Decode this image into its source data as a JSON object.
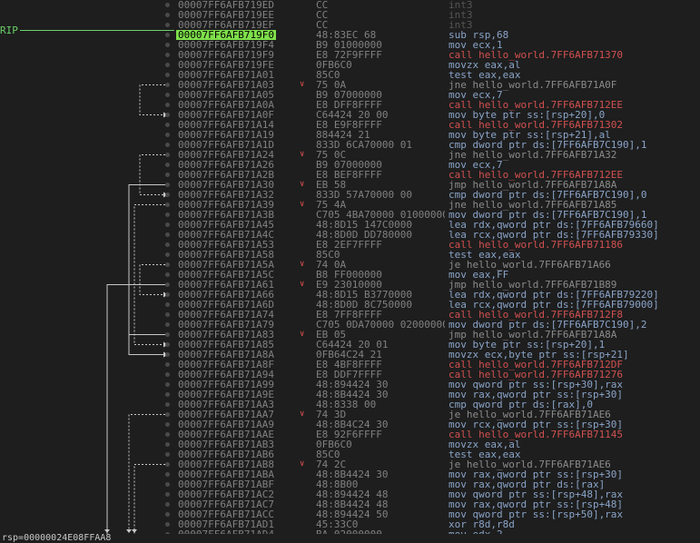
{
  "rip_label": "RIP",
  "rip_index": 3,
  "colors": {
    "rip_highlight": "#7fe04b",
    "call": "#d25050",
    "jump": "#e0604d",
    "normal": "#8aa4c8",
    "int3": "#555555"
  },
  "rows": [
    {
      "addr": "00007FF6AFB719ED",
      "bytes": "CC",
      "instr": "int3",
      "kind": "int3",
      "jmp": false
    },
    {
      "addr": "00007FF6AFB719EE",
      "bytes": "CC",
      "instr": "int3",
      "kind": "int3",
      "jmp": false
    },
    {
      "addr": "00007FF6AFB719EF",
      "bytes": "CC",
      "instr": "int3",
      "kind": "int3",
      "jmp": false
    },
    {
      "addr": "00007FF6AFB719F0",
      "bytes": "48:83EC 68",
      "instr": "sub rsp,68",
      "kind": "plain",
      "jmp": false
    },
    {
      "addr": "00007FF6AFB719F4",
      "bytes": "B9 01000000",
      "instr": "mov ecx,1",
      "kind": "plain",
      "jmp": false
    },
    {
      "addr": "00007FF6AFB719F9",
      "bytes": "E8 72F9FFFF",
      "instr": "call hello_world.7FF6AFB71370",
      "kind": "call",
      "jmp": false
    },
    {
      "addr": "00007FF6AFB719FE",
      "bytes": "0FB6C0",
      "instr": "movzx eax,al",
      "kind": "plain",
      "jmp": false
    },
    {
      "addr": "00007FF6AFB71A01",
      "bytes": "85C0",
      "instr": "test eax,eax",
      "kind": "plain",
      "jmp": false
    },
    {
      "addr": "00007FF6AFB71A03",
      "bytes": "75 0A",
      "instr": "jne hello_world.7FF6AFB71A0F",
      "kind": "jump",
      "jmp": true
    },
    {
      "addr": "00007FF6AFB71A05",
      "bytes": "B9 07000000",
      "instr": "mov ecx,7",
      "kind": "plain",
      "jmp": false
    },
    {
      "addr": "00007FF6AFB71A0A",
      "bytes": "E8 DFF8FFFF",
      "instr": "call hello_world.7FF6AFB712EE",
      "kind": "call",
      "jmp": false
    },
    {
      "addr": "00007FF6AFB71A0F",
      "bytes": "C64424 20 00",
      "instr": "mov byte ptr ss:[rsp+20],0",
      "kind": "plain",
      "jmp": false
    },
    {
      "addr": "00007FF6AFB71A14",
      "bytes": "E8 E9F8FFFF",
      "instr": "call hello_world.7FF6AFB71302",
      "kind": "call",
      "jmp": false
    },
    {
      "addr": "00007FF6AFB71A19",
      "bytes": "884424 21",
      "instr": "mov byte ptr ss:[rsp+21],al",
      "kind": "plain",
      "jmp": false
    },
    {
      "addr": "00007FF6AFB71A1D",
      "bytes": "833D 6CA70000 01",
      "instr": "cmp dword ptr ds:[7FF6AFB7C190],1",
      "kind": "plain",
      "jmp": false
    },
    {
      "addr": "00007FF6AFB71A24",
      "bytes": "75 0C",
      "instr": "jne hello_world.7FF6AFB71A32",
      "kind": "jump",
      "jmp": true
    },
    {
      "addr": "00007FF6AFB71A26",
      "bytes": "B9 07000000",
      "instr": "mov ecx,7",
      "kind": "plain",
      "jmp": false
    },
    {
      "addr": "00007FF6AFB71A2B",
      "bytes": "E8 BEF8FFFF",
      "instr": "call hello_world.7FF6AFB712EE",
      "kind": "call",
      "jmp": false
    },
    {
      "addr": "00007FF6AFB71A30",
      "bytes": "EB 58",
      "instr": "jmp hello_world.7FF6AFB71A8A",
      "kind": "jump",
      "jmp": true
    },
    {
      "addr": "00007FF6AFB71A32",
      "bytes": "833D 57A70000 00",
      "instr": "cmp dword ptr ds:[7FF6AFB7C190],0",
      "kind": "plain",
      "jmp": false
    },
    {
      "addr": "00007FF6AFB71A39",
      "bytes": "75 4A",
      "instr": "jne hello_world.7FF6AFB71A85",
      "kind": "jump",
      "jmp": true
    },
    {
      "addr": "00007FF6AFB71A3B",
      "bytes": "C705 4BA70000 01000000",
      "instr": "mov dword ptr ds:[7FF6AFB7C190],1",
      "kind": "plain",
      "jmp": false
    },
    {
      "addr": "00007FF6AFB71A45",
      "bytes": "48:8D15 147C0000",
      "instr": "lea rdx,qword ptr ds:[7FF6AFB79660]",
      "kind": "plain",
      "jmp": false
    },
    {
      "addr": "00007FF6AFB71A4C",
      "bytes": "48:8D0D DD780000",
      "instr": "lea rcx,qword ptr ds:[7FF6AFB79330]",
      "kind": "plain",
      "jmp": false
    },
    {
      "addr": "00007FF6AFB71A53",
      "bytes": "E8 2EF7FFFF",
      "instr": "call hello_world.7FF6AFB71186",
      "kind": "call",
      "jmp": false
    },
    {
      "addr": "00007FF6AFB71A58",
      "bytes": "85C0",
      "instr": "test eax,eax",
      "kind": "plain",
      "jmp": false
    },
    {
      "addr": "00007FF6AFB71A5A",
      "bytes": "74 0A",
      "instr": "je hello_world.7FF6AFB71A66",
      "kind": "jump",
      "jmp": true
    },
    {
      "addr": "00007FF6AFB71A5C",
      "bytes": "B8 FF000000",
      "instr": "mov eax,FF",
      "kind": "plain",
      "jmp": false
    },
    {
      "addr": "00007FF6AFB71A61",
      "bytes": "E9 23010000",
      "instr": "jmp hello_world.7FF6AFB71B89",
      "kind": "jump",
      "jmp": true
    },
    {
      "addr": "00007FF6AFB71A66",
      "bytes": "48:8D15 B3770000",
      "instr": "lea rdx,qword ptr ds:[7FF6AFB79220]",
      "kind": "plain",
      "jmp": false
    },
    {
      "addr": "00007FF6AFB71A6D",
      "bytes": "48:8D0D 8C750000",
      "instr": "lea rcx,qword ptr ds:[7FF6AFB79000]",
      "kind": "plain",
      "jmp": false
    },
    {
      "addr": "00007FF6AFB71A74",
      "bytes": "E8 7FF8FFFF",
      "instr": "call hello_world.7FF6AFB712F8",
      "kind": "call",
      "jmp": false
    },
    {
      "addr": "00007FF6AFB71A79",
      "bytes": "C705 0DA70000 02000000",
      "instr": "mov dword ptr ds:[7FF6AFB7C190],2",
      "kind": "plain",
      "jmp": false
    },
    {
      "addr": "00007FF6AFB71A83",
      "bytes": "EB 05",
      "instr": "jmp hello_world.7FF6AFB71A8A",
      "kind": "jump",
      "jmp": true
    },
    {
      "addr": "00007FF6AFB71A85",
      "bytes": "C64424 20 01",
      "instr": "mov byte ptr ss:[rsp+20],1",
      "kind": "plain",
      "jmp": false
    },
    {
      "addr": "00007FF6AFB71A8A",
      "bytes": "0FB64C24 21",
      "instr": "movzx ecx,byte ptr ss:[rsp+21]",
      "kind": "plain",
      "jmp": false
    },
    {
      "addr": "00007FF6AFB71A8F",
      "bytes": "E8 4BF8FFFF",
      "instr": "call hello_world.7FF6AFB712DF",
      "kind": "call",
      "jmp": false
    },
    {
      "addr": "00007FF6AFB71A94",
      "bytes": "E8 DDF7FFFF",
      "instr": "call hello_world.7FF6AFB71276",
      "kind": "call",
      "jmp": false
    },
    {
      "addr": "00007FF6AFB71A99",
      "bytes": "48:894424 30",
      "instr": "mov qword ptr ss:[rsp+30],rax",
      "kind": "plain",
      "jmp": false
    },
    {
      "addr": "00007FF6AFB71A9E",
      "bytes": "48:8B4424 30",
      "instr": "mov rax,qword ptr ss:[rsp+30]",
      "kind": "plain",
      "jmp": false
    },
    {
      "addr": "00007FF6AFB71AA3",
      "bytes": "48:8338 00",
      "instr": "cmp qword ptr ds:[rax],0",
      "kind": "plain",
      "jmp": false
    },
    {
      "addr": "00007FF6AFB71AA7",
      "bytes": "74 3D",
      "instr": "je hello_world.7FF6AFB71AE6",
      "kind": "jump",
      "jmp": true
    },
    {
      "addr": "00007FF6AFB71AA9",
      "bytes": "48:8B4C24 30",
      "instr": "mov rcx,qword ptr ss:[rsp+30]",
      "kind": "plain",
      "jmp": false
    },
    {
      "addr": "00007FF6AFB71AAE",
      "bytes": "E8 92F6FFFF",
      "instr": "call hello_world.7FF6AFB71145",
      "kind": "call",
      "jmp": false
    },
    {
      "addr": "00007FF6AFB71AB3",
      "bytes": "0FB6C0",
      "instr": "movzx eax,al",
      "kind": "plain",
      "jmp": false
    },
    {
      "addr": "00007FF6AFB71AB6",
      "bytes": "85C0",
      "instr": "test eax,eax",
      "kind": "plain",
      "jmp": false
    },
    {
      "addr": "00007FF6AFB71AB8",
      "bytes": "74 2C",
      "instr": "je hello_world.7FF6AFB71AE6",
      "kind": "jump",
      "jmp": true
    },
    {
      "addr": "00007FF6AFB71ABA",
      "bytes": "48:8B4424 30",
      "instr": "mov rax,qword ptr ss:[rsp+30]",
      "kind": "plain",
      "jmp": false
    },
    {
      "addr": "00007FF6AFB71ABF",
      "bytes": "48:8B00",
      "instr": "mov rax,qword ptr ds:[rax]",
      "kind": "plain",
      "jmp": false
    },
    {
      "addr": "00007FF6AFB71AC2",
      "bytes": "48:894424 48",
      "instr": "mov qword ptr ss:[rsp+48],rax",
      "kind": "plain",
      "jmp": false
    },
    {
      "addr": "00007FF6AFB71AC7",
      "bytes": "48:8B4424 48",
      "instr": "mov rax,qword ptr ss:[rsp+48]",
      "kind": "plain",
      "jmp": false
    },
    {
      "addr": "00007FF6AFB71ACC",
      "bytes": "48:894424 50",
      "instr": "mov qword ptr ss:[rsp+50],rax",
      "kind": "plain",
      "jmp": false
    },
    {
      "addr": "00007FF6AFB71AD1",
      "bytes": "45:33C0",
      "instr": "xor r8d,r8d",
      "kind": "plain",
      "jmp": false
    },
    {
      "addr": "00007FF6AFB71AD4",
      "bytes": "BA 02000000",
      "instr": "mov edx,2",
      "kind": "plain",
      "jmp": false
    }
  ],
  "status": "rsp=00000024E08FFAA8"
}
